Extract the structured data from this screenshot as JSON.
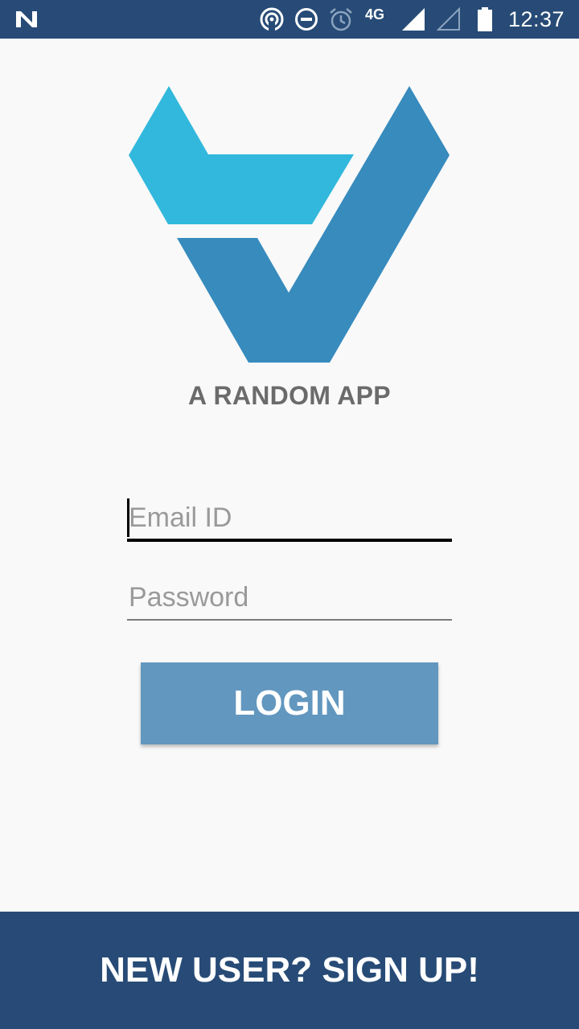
{
  "status_bar": {
    "network": "4G",
    "time": "12:37",
    "icons": [
      "n-icon",
      "hotspot-icon",
      "do-not-disturb-icon",
      "alarm-icon",
      "signal-icon",
      "signal-empty-icon",
      "battery-icon"
    ]
  },
  "app": {
    "name": "A RANDOM APP",
    "colors": {
      "primary_dark": "#274b76",
      "button": "#6297bf",
      "logo_light": "#32b8dc",
      "logo_dark": "#378bbd"
    }
  },
  "form": {
    "email": {
      "placeholder": "Email ID",
      "value": ""
    },
    "password": {
      "placeholder": "Password",
      "value": ""
    },
    "login_label": "LOGIN"
  },
  "footer": {
    "signup_label": "NEW USER? SIGN UP!"
  }
}
